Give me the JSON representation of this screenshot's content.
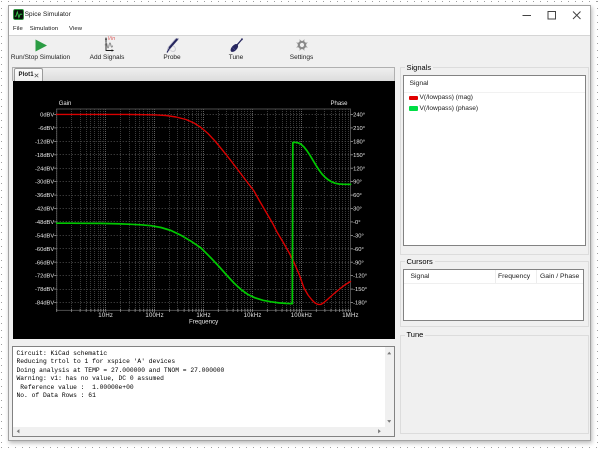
{
  "window": {
    "title": "Spice Simulator",
    "caption_buttons": {
      "minimize": "minimize",
      "maximize": "maximize",
      "close": "close"
    }
  },
  "menu": {
    "items": [
      {
        "label": "File"
      },
      {
        "label": "Simulation"
      },
      {
        "label": "View"
      }
    ]
  },
  "toolbar": {
    "items": [
      {
        "label": "Run/Stop Simulation",
        "icon": "run-icon"
      },
      {
        "label": "Add Signals",
        "icon": "add-signals-icon"
      },
      {
        "label": "Probe",
        "icon": "probe-icon"
      },
      {
        "label": "Tune",
        "icon": "tune-icon"
      },
      {
        "label": "Settings",
        "icon": "settings-icon"
      }
    ],
    "add_signals_icon_text": "Vin"
  },
  "tabs": {
    "active": "Plot1"
  },
  "signals_panel": {
    "group_label": "Signals",
    "column_header": "Signal",
    "rows": [
      {
        "name": "V(/lowpass) (mag)",
        "color": "#e00000"
      },
      {
        "name": "V(/lowpass) (phase)",
        "color": "#00dd45"
      }
    ]
  },
  "cursors_panel": {
    "group_label": "Cursors",
    "columns": [
      "Signal",
      "Frequency",
      "Gain / Phase"
    ]
  },
  "tune_panel": {
    "group_label": "Tune"
  },
  "console": {
    "lines": [
      "Circuit: KiCad schematic",
      "Reducing trtol to 1 for xspice 'A' devices",
      "Doing analysis at TEMP = 27.000000 and TNOM = 27.000000",
      "Warning: v1: has no value, DC 0 assumed",
      " Reference value :  1.00000e+00",
      "No. of Data Rows : 61"
    ]
  },
  "chart_data": {
    "type": "line",
    "title": "",
    "xlabel": "Frequency",
    "ylabel_left": "Gain",
    "ylabel_right": "Phase",
    "x_log_range": [
      1,
      1000000
    ],
    "x_tick_labels": [
      "10Hz",
      "100Hz",
      "1kHz",
      "10kHz",
      "100kHz",
      "1MHz"
    ],
    "x_tick_decades": [
      1,
      2,
      3,
      4,
      5,
      6
    ],
    "y_left_ticks": [
      "0dBV",
      "-6dBV",
      "-12dBV",
      "-18dBV",
      "-24dBV",
      "-30dBV",
      "-36dBV",
      "-42dBV",
      "-48dBV",
      "-54dBV",
      "-60dBV",
      "-66dBV",
      "-72dBV",
      "-78dBV",
      "-84dBV"
    ],
    "y_left_range": [
      0,
      -84
    ],
    "y_right_ticks": [
      "240°",
      "210°",
      "180°",
      "150°",
      "120°",
      "90°",
      "60°",
      "30°",
      "-0°",
      "-30°",
      "-60°",
      "-90°",
      "-120°",
      "-150°",
      "-180°"
    ],
    "y_right_range": [
      240,
      -180
    ],
    "grid": true,
    "colors": {
      "mag": "#d80000",
      "phase": "#00c800"
    },
    "series": [
      {
        "name": "V(/lowpass) (mag)",
        "axis": "left",
        "unit": "dBV",
        "x": [
          1.0,
          1.959,
          3.966,
          8.03,
          16.26,
          32.91,
          66.63,
          106.6,
          170.7,
          273.1,
          437.1,
          636.7,
          884.9,
          1230.0,
          1709.0,
          2375.0,
          3460.0,
          5041.0,
          7343.0,
          10700.0,
          13530.0,
          18810.0,
          26140.0,
          31550.0,
          41830.0,
          55460.0,
          70170.0,
          88760.0,
          112300.0,
          135500.0,
          163600.0,
          188400.0,
          216900.0,
          249800.0,
          287600.0,
          347100.0,
          439100.0,
          582200.0,
          772000.0,
          999900.0
        ],
        "y": [
          0.04,
          0.04,
          0.04,
          0.04,
          0.04,
          0.0,
          -0.09,
          -0.18,
          -0.45,
          -1.12,
          -2.23,
          -3.8,
          -5.81,
          -8.49,
          -11.84,
          -15.64,
          -20.11,
          -24.8,
          -29.49,
          -34.18,
          -38.2,
          -43.56,
          -48.93,
          -52.5,
          -56.97,
          -61.66,
          -66.13,
          -71.27,
          -77.52,
          -80.65,
          -82.88,
          -84.22,
          -84.85,
          -84.85,
          -84.0,
          -82.44,
          -80.43,
          -78.19,
          -76.09,
          -74.62
        ]
      },
      {
        "name": "V(/lowpass) (phase)",
        "axis": "right",
        "unit": "deg",
        "x": [
          1.0,
          1.959,
          3.966,
          8.03,
          12.85,
          20.57,
          32.91,
          52.67,
          84.29,
          134.9,
          215.9,
          345.5,
          552.9,
          884.9,
          1416.0,
          2063.0,
          3005.0,
          4176.0,
          5804.0,
          8067.0,
          11210.0,
          16330.0,
          23790.0,
          34660.0,
          48170.0,
          64770.0,
          66320.0,
          73540.0,
          84690.0,
          97520.0,
          112300.0,
          129300.0,
          148900.0,
          171400.0,
          197400.0,
          227300.0,
          261800.0,
          301400.0,
          347100.0,
          399700.0,
          482400.0,
          582200.0,
          736600.0,
          999900.0
        ],
        "y": [
          -2.8,
          -2.8,
          -3.1,
          -3.3,
          -3.7,
          -4.4,
          -5.3,
          -6.4,
          -8.4,
          -12.4,
          -19.1,
          -29.9,
          -43.1,
          -58.2,
          -80.6,
          -99.6,
          -119.7,
          -136.4,
          -151.0,
          -162.1,
          -169.5,
          -175.1,
          -178.4,
          -180.9,
          -182.0,
          -182.7,
          177.4,
          177.9,
          176.8,
          173.6,
          167.4,
          158.9,
          148.9,
          137.7,
          126.5,
          116.0,
          107.1,
          99.9,
          94.6,
          90.3,
          86.5,
          84.7,
          84.1,
          83.8
        ]
      }
    ]
  }
}
